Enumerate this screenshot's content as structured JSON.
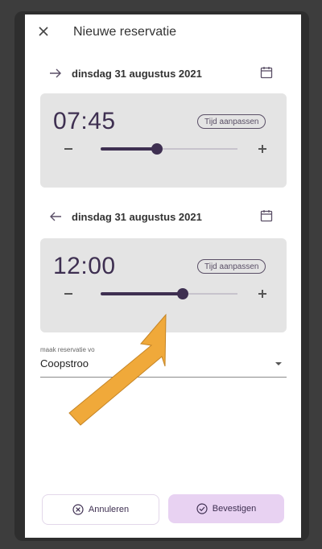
{
  "header": {
    "title": "Nieuwe reservatie"
  },
  "start": {
    "date": "dinsdag 31 augustus 2021",
    "time": "07:45",
    "adjust_label": "Tijd aanpassen",
    "slider_fraction": 0.41
  },
  "end": {
    "date": "dinsdag 31 augustus 2021",
    "time": "12:00",
    "adjust_label": "Tijd aanpassen",
    "slider_fraction": 0.6
  },
  "reservation_for": {
    "label": "maak reservatie vo",
    "value": "Coopstroo"
  },
  "actions": {
    "cancel_label": "Annuleren",
    "confirm_label": "Bevestigen"
  },
  "colors": {
    "accent": "#3e2f51",
    "card_bg": "#e4e4e4",
    "confirm_bg": "#e8d2f2",
    "annotation_arrow": "#f0a93a"
  }
}
